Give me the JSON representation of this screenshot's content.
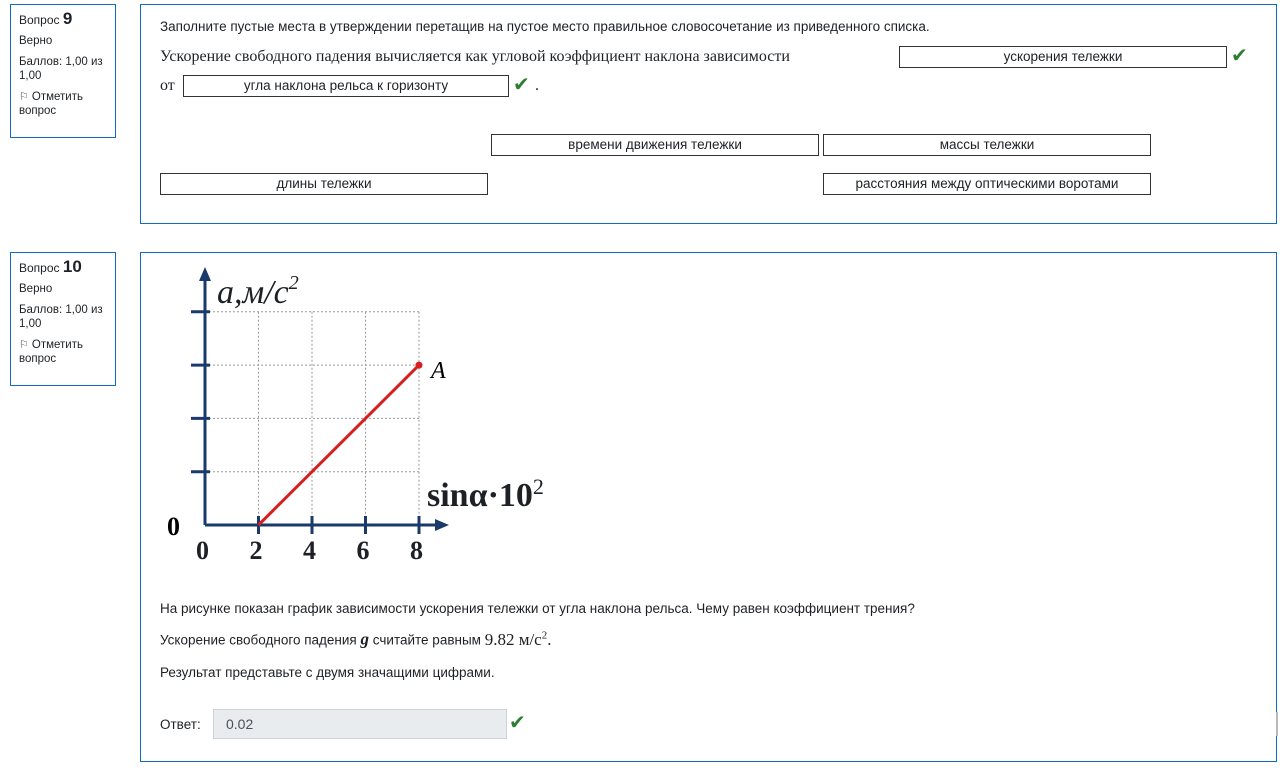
{
  "q9": {
    "info": {
      "label": "Вопрос",
      "number": "9",
      "status": "Верно",
      "score": "Баллов: 1,00 из 1,00",
      "flag_label": "Отметить вопрос"
    },
    "prompt": "Заполните пустые места в утверждении перетащив на пустое место  правильное словосочетание из приведенного списка.",
    "sentence_start": "Ускорение свободного падения вычисляется как угловой коэффициент наклона зависимости",
    "sentence_mid": "от",
    "sentence_end": ".",
    "drop1_value": "ускорения тележки",
    "drop2_value": "угла наклона рельса к горизонту",
    "choices": [
      "времени движения тележки",
      "массы тележки",
      "длины тележки",
      "расстояния между оптическими воротами"
    ]
  },
  "q10": {
    "info": {
      "label": "Вопрос",
      "number": "10",
      "status": "Верно",
      "score": "Баллов: 1,00 из 1,00",
      "flag_label": "Отметить вопрос"
    },
    "graph": {
      "y_label": "a,м/с",
      "y_label_exp": "2",
      "x_label": "sinα·10",
      "x_label_exp": "2",
      "origin_label": "0",
      "y_zero_label": "0",
      "x_ticks": [
        "0",
        "2",
        "4",
        "6",
        "8"
      ],
      "point_label": "A",
      "line_color": "#d62020"
    },
    "question": "На рисунке показан график зависимости ускорения тележки от угла наклона рельса. Чему равен коэффициент трения?",
    "g_text_before": "Ускорение свободного падения",
    "g_symbol": "g",
    "g_text_mid": "считайте равным",
    "g_value": "9.82 м/с",
    "g_exp": "2",
    "g_end": ".",
    "result_text": "Результат представьте с двумя значащими цифрами.",
    "answer_label": "Ответ:",
    "answer_value": "0.02"
  },
  "chart_data": {
    "type": "line",
    "x": [
      2,
      8
    ],
    "y": [
      0,
      3
    ],
    "xlabel": "sinα·10²",
    "ylabel": "a,м/с²",
    "x_ticks": [
      0,
      2,
      4,
      6,
      8
    ],
    "grid": true,
    "point_label": "A"
  }
}
